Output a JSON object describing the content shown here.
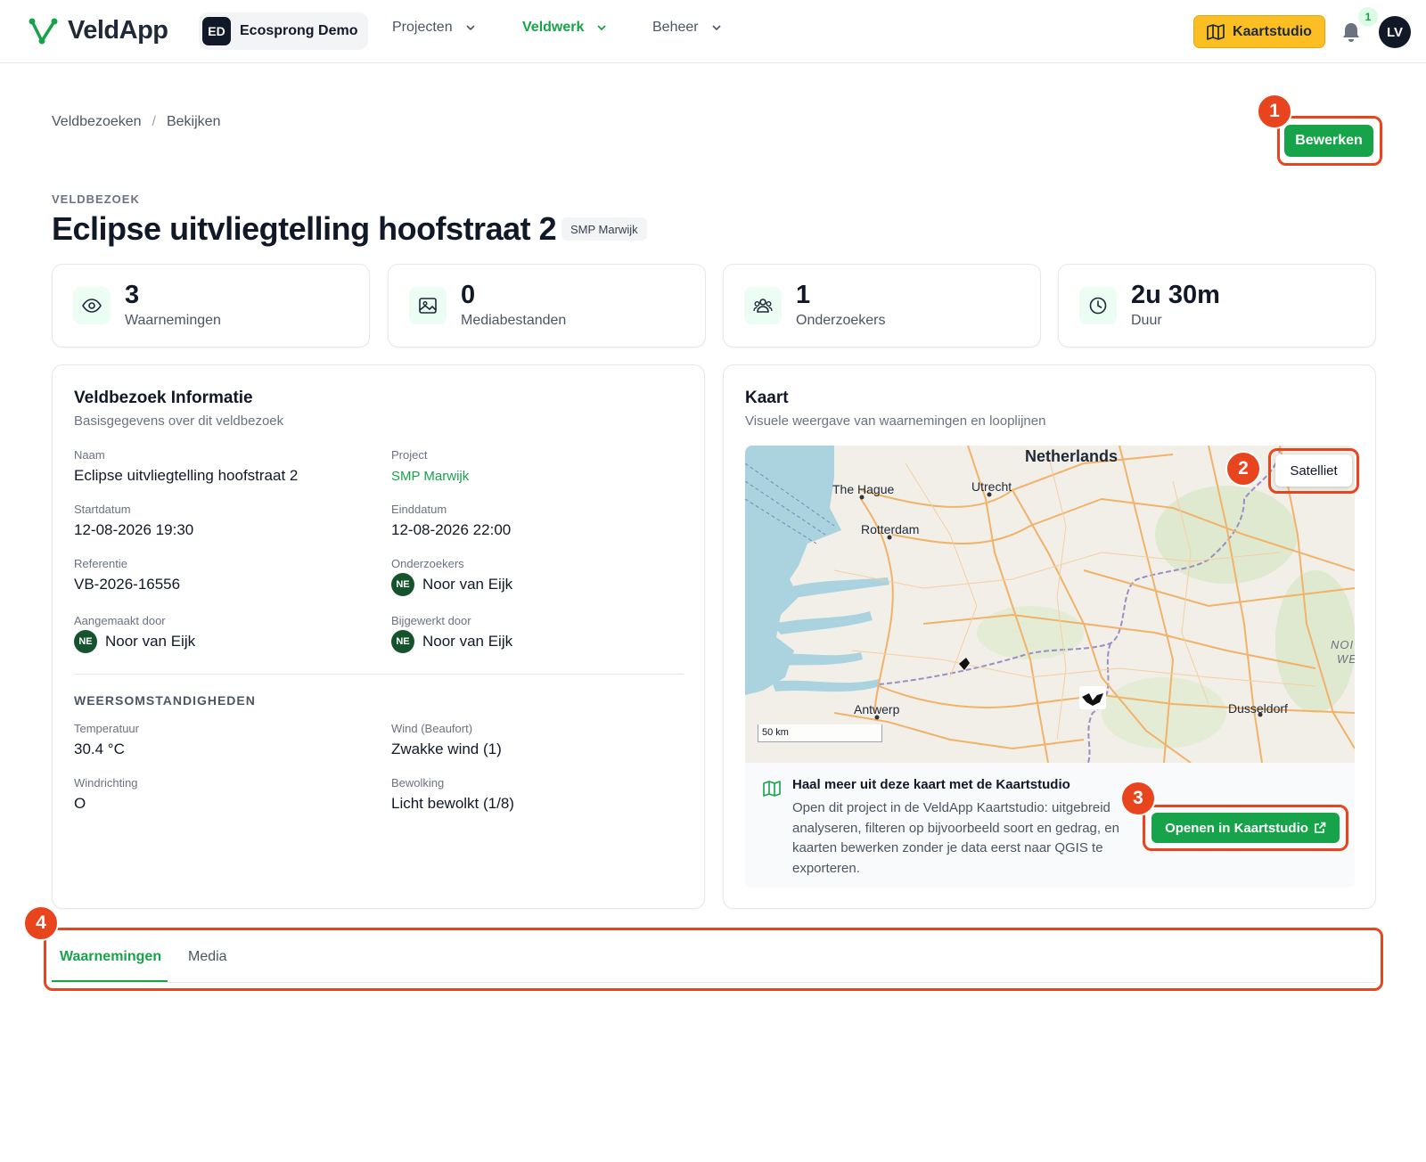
{
  "app": {
    "name": "VeldApp",
    "org_initials": "ED",
    "org_name": "Ecosprong Demo",
    "nav": [
      "Projecten",
      "Veldwerk",
      "Beheer"
    ],
    "studio_button": "Kaartstudio",
    "notification_count": "1",
    "user_initials": "LV",
    "accent": "#16a34a",
    "studio_color": "#fbbf24"
  },
  "breadcrumb": [
    "Veldbezoeken",
    "Bekijken"
  ],
  "edit_label": "Bewerken",
  "eyebrow": "VELDBEZOEK",
  "title": "Eclipse uitvliegtelling hoofstraat 2",
  "project_badge": "SMP Marwijk",
  "stats": [
    {
      "value": "3",
      "label": "Waarnemingen",
      "icon": "eye-icon"
    },
    {
      "value": "0",
      "label": "Mediabestanden",
      "icon": "image-icon"
    },
    {
      "value": "1",
      "label": "Onderzoekers",
      "icon": "users-icon"
    },
    {
      "value": "2u 30m",
      "label": "Duur",
      "icon": "clock-icon"
    }
  ],
  "info": {
    "title": "Veldbezoek Informatie",
    "subtitle": "Basisgegevens over dit veldbezoek",
    "fields": {
      "naam": {
        "label": "Naam",
        "value": "Eclipse uitvliegtelling hoofstraat 2"
      },
      "project": {
        "label": "Project",
        "value": "SMP Marwijk"
      },
      "start": {
        "label": "Startdatum",
        "value": "12-08-2026 19:30"
      },
      "end": {
        "label": "Einddatum",
        "value": "12-08-2026 22:00"
      },
      "ref": {
        "label": "Referentie",
        "value": "VB-2026-16556"
      },
      "researchers": {
        "label": "Onderzoekers",
        "initials": "NE",
        "value": "Noor van Eijk"
      },
      "created": {
        "label": "Aangemaakt door",
        "initials": "NE",
        "value": "Noor van Eijk"
      },
      "updated": {
        "label": "Bijgewerkt door",
        "initials": "NE",
        "value": "Noor van Eijk"
      }
    },
    "weather_heading": "WEERSOMSTANDIGHEDEN",
    "weather": {
      "temp": {
        "label": "Temperatuur",
        "value": "30.4 °C"
      },
      "wind": {
        "label": "Wind (Beaufort)",
        "value": "Zwakke wind (1)"
      },
      "dir": {
        "label": "Windrichting",
        "value": "O"
      },
      "cloud": {
        "label": "Bewolking",
        "value": "Licht bewolkt (1/8)"
      }
    }
  },
  "map": {
    "title": "Kaart",
    "subtitle": "Visuele weergave van waarnemingen en looplijnen",
    "satellite_label": "Satelliet",
    "scale": "50 km",
    "labels": {
      "netherlands": "Netherlands",
      "the_hague": "The Hague",
      "utrecht": "Utrecht",
      "rotterdam": "Rotterdam",
      "antwerp": "Antwerp",
      "dusseldorf": "Dusseldorf",
      "nordrhein_1": "NOI",
      "nordrhein_2": "WE"
    },
    "promo_title": "Haal meer uit deze kaart met de Kaartstudio",
    "promo_text": "Open dit project in de VeldApp Kaartstudio: uitgebreid analyseren, filteren op bijvoorbeeld soort en gedrag, en kaarten bewerken zonder je data eerst naar QGIS te exporteren.",
    "open_label": "Openen in Kaartstudio"
  },
  "tabs": [
    "Waarnemingen",
    "Media"
  ],
  "annotations": [
    "1",
    "2",
    "3",
    "4"
  ]
}
